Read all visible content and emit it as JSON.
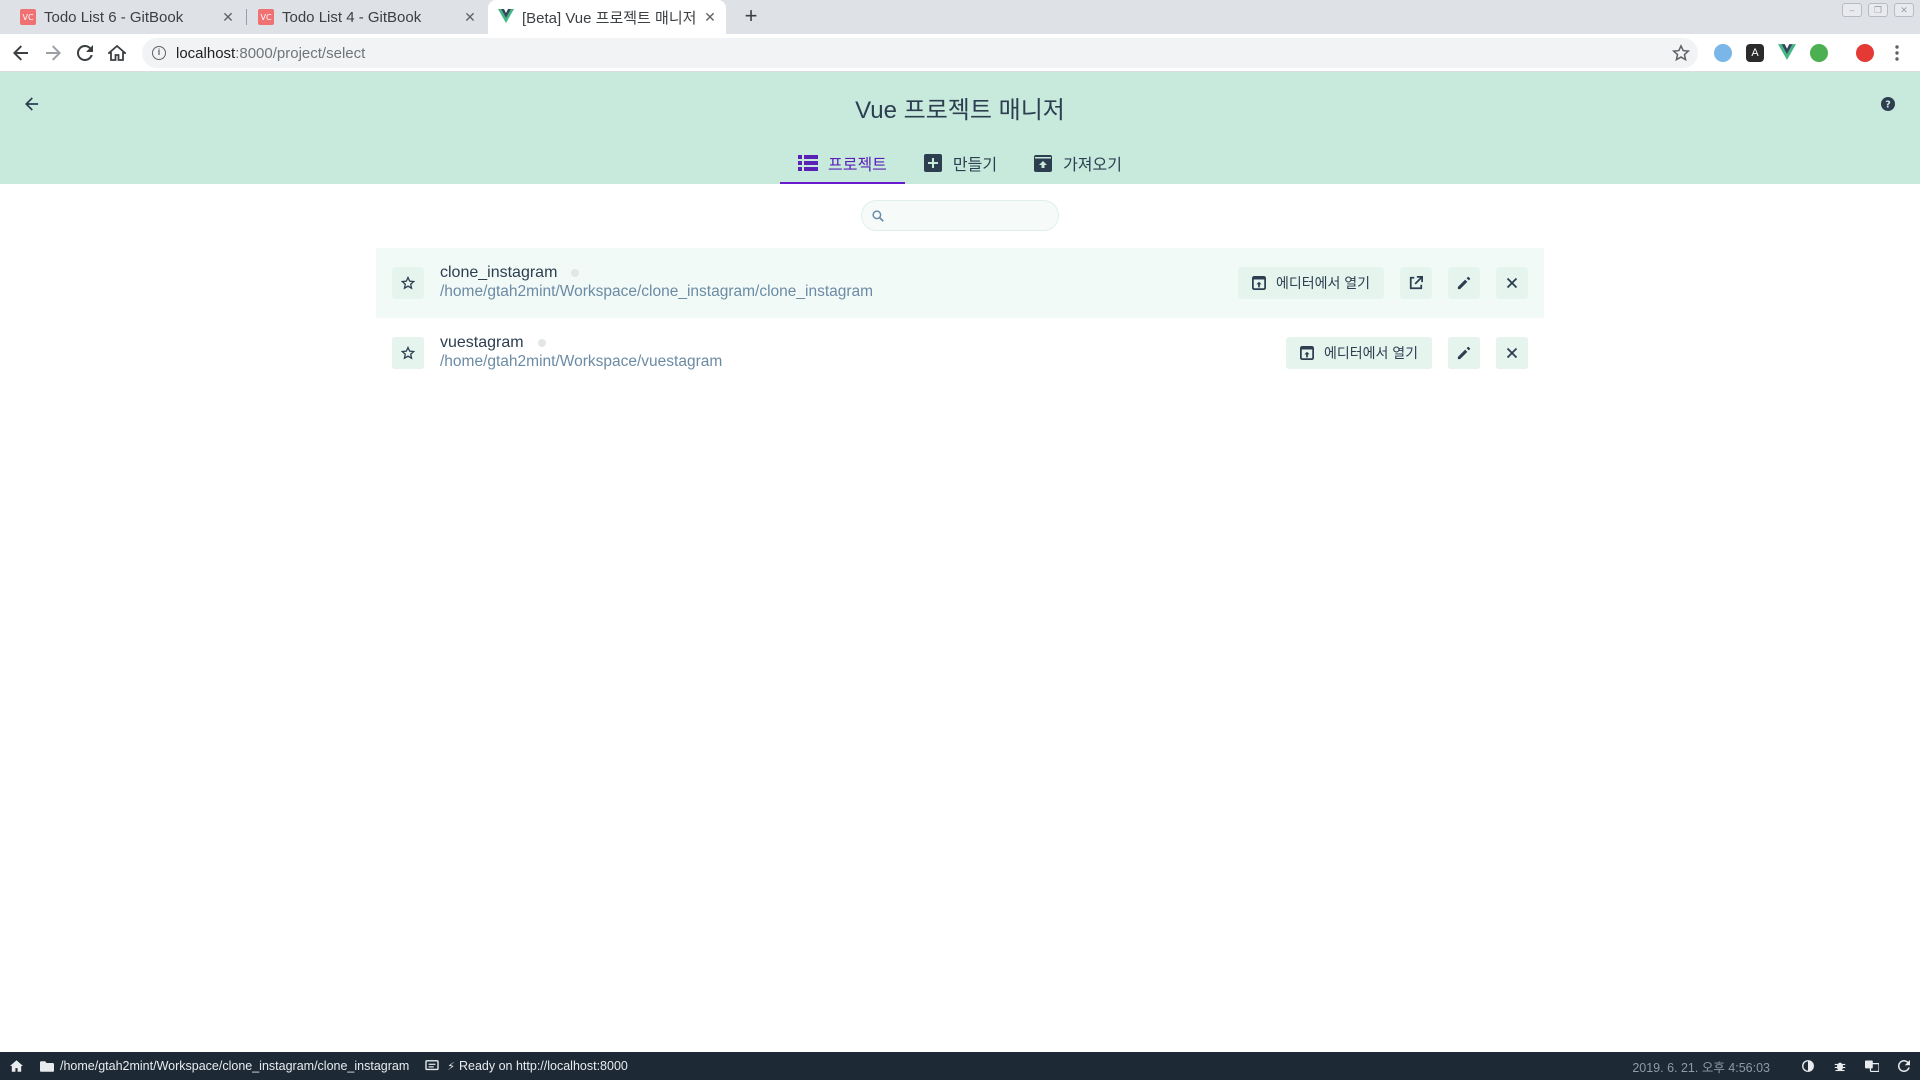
{
  "browser": {
    "tabs": [
      {
        "title": "Todo List 6 - GitBook",
        "favicon": "gitbook-icon",
        "active": false
      },
      {
        "title": "Todo List 4 - GitBook",
        "favicon": "gitbook-icon",
        "active": false
      },
      {
        "title": "[Beta] Vue 프로젝트 매니저",
        "favicon": "vue-icon",
        "active": true
      }
    ],
    "favicon_text": "VC",
    "url_host": "localhost",
    "url_path": ":8000/project/select"
  },
  "header": {
    "title": "Vue 프로젝트 매니저",
    "tabs": [
      {
        "label": "프로젝트",
        "icon": "list-icon",
        "selected": true
      },
      {
        "label": "만들기",
        "icon": "add-box-icon",
        "selected": false
      },
      {
        "label": "가져오기",
        "icon": "unarchive-icon",
        "selected": false
      }
    ]
  },
  "search": {
    "placeholder": "",
    "value": ""
  },
  "projects": [
    {
      "name": "clone_instagram",
      "path": "/home/gtah2mint/Workspace/clone_instagram/clone_instagram",
      "open_in_editor_label": "에디터에서 열기",
      "has_open_button": true
    },
    {
      "name": "vuestagram",
      "path": "/home/gtah2mint/Workspace/vuestagram",
      "open_in_editor_label": "에디터에서 열기",
      "has_open_button": false
    }
  ],
  "statusbar": {
    "cwd": "/home/gtah2mint/Workspace/clone_instagram/clone_instagram",
    "server_status": "Ready on http://localhost:8000",
    "datetime": "2019. 6. 21. 오후 4:56:03"
  },
  "colors": {
    "header_bg": "#c7eadd",
    "accent": "#6a1bd0",
    "button_bg": "#e6f4ee",
    "path_text": "#6b8ba4",
    "statusbar_bg": "#1d2935"
  }
}
